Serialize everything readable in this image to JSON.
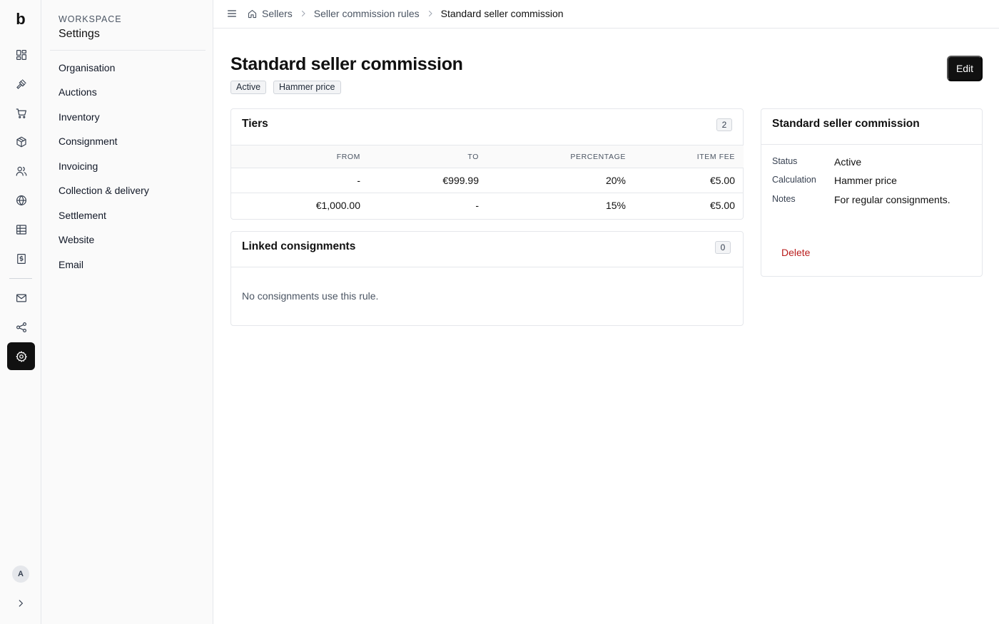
{
  "app": {
    "logo": "b",
    "user_initial": "A"
  },
  "rail": {
    "items": [
      {
        "icon": "dashboard-icon"
      },
      {
        "icon": "gavel-icon"
      },
      {
        "icon": "cart-icon"
      },
      {
        "icon": "package-icon"
      },
      {
        "icon": "users-icon"
      },
      {
        "icon": "globe-icon"
      },
      {
        "icon": "table-icon"
      },
      {
        "icon": "invoice-icon"
      },
      {
        "icon": "mail-icon"
      },
      {
        "icon": "share-icon"
      },
      {
        "icon": "gear-icon",
        "active": true
      }
    ]
  },
  "sidebar": {
    "eyebrow": "WORKSPACE",
    "title": "Settings",
    "items": [
      {
        "label": "Organisation"
      },
      {
        "label": "Auctions"
      },
      {
        "label": "Inventory"
      },
      {
        "label": "Consignment"
      },
      {
        "label": "Invoicing"
      },
      {
        "label": "Collection & delivery"
      },
      {
        "label": "Settlement"
      },
      {
        "label": "Website"
      },
      {
        "label": "Email"
      }
    ]
  },
  "breadcrumb": {
    "items": [
      "Sellers",
      "Seller commission rules"
    ],
    "current": "Standard seller commission"
  },
  "page": {
    "title": "Standard seller commission",
    "badges": [
      "Active",
      "Hammer price"
    ],
    "edit_label": "Edit"
  },
  "tiers": {
    "title": "Tiers",
    "count": "2",
    "columns": [
      "FROM",
      "TO",
      "PERCENTAGE",
      "ITEM FEE"
    ],
    "rows": [
      [
        "-",
        "€999.99",
        "20%",
        "€5.00"
      ],
      [
        "€1,000.00",
        "-",
        "15%",
        "€5.00"
      ]
    ]
  },
  "linked": {
    "title": "Linked consignments",
    "count": "0",
    "empty_text": "No consignments use this rule."
  },
  "details": {
    "title": "Standard seller commission",
    "fields": [
      {
        "label": "Status",
        "value": "Active"
      },
      {
        "label": "Calculation",
        "value": "Hammer price"
      },
      {
        "label": "Notes",
        "value": "For regular consignments."
      }
    ],
    "delete_label": "Delete"
  },
  "colors": {
    "accent": "#111111",
    "danger": "#b91c1c",
    "border": "#e5e7eb"
  }
}
